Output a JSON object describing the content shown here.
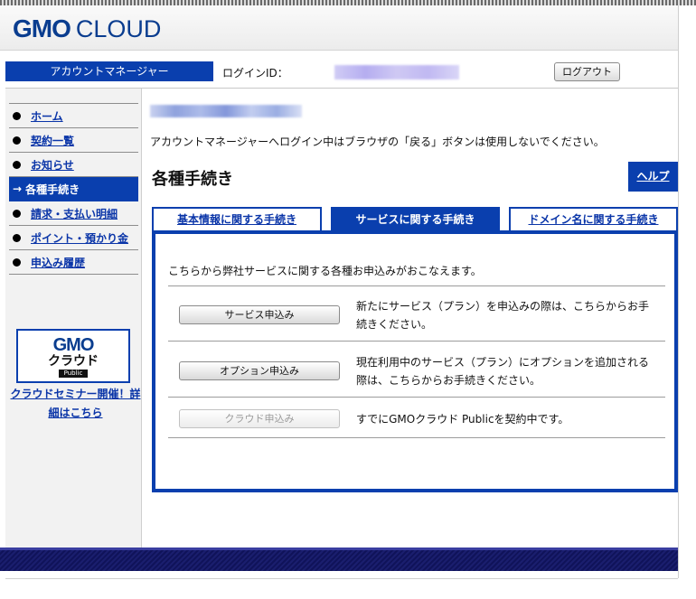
{
  "header": {
    "logo_primary": "GMO",
    "logo_secondary": "CLOUD"
  },
  "account_bar": {
    "title": "アカウントマネージャー",
    "login_label": "ログインID：",
    "logout_label": "ログアウト"
  },
  "sidebar": {
    "items": [
      {
        "label": "ホーム",
        "active": false
      },
      {
        "label": "契約一覧",
        "active": false
      },
      {
        "label": "お知らせ",
        "active": false
      },
      {
        "label": "各種手続き",
        "active": true
      },
      {
        "label": "請求・支払い明細",
        "active": false
      },
      {
        "label": "ポイント・預かり金",
        "active": false
      },
      {
        "label": "申込み履歴",
        "active": false
      }
    ],
    "active_arrow": "→",
    "banner": {
      "gmo": "GMO",
      "cloud": "クラウド",
      "public": "Public"
    },
    "seminar_link": "クラウドセミナー開催！詳細はこちら"
  },
  "main": {
    "notice": "アカウントマネージャーへログイン中はブラウザの「戻る」ボタンは使用しないでください。",
    "section_title": "各種手続き",
    "help_label": "ヘルプ",
    "tabs": [
      {
        "label": "基本情報に関する手続き",
        "active": false
      },
      {
        "label": "サービスに関する手続き",
        "active": true
      },
      {
        "label": "ドメイン名に関する手続き",
        "active": false
      }
    ],
    "panel_intro": "こちらから弊社サービスに関する各種お申込みがおこなえます。",
    "services": [
      {
        "button": "サービス申込み",
        "description": "新たにサービス（プラン）を申込みの際は、こちらからお手続きください。",
        "enabled": true
      },
      {
        "button": "オプション申込み",
        "description": "現在利用中のサービス（プラン）にオプションを追加される際は、こちらからお手続きください。",
        "enabled": true
      },
      {
        "button": "クラウド申込み",
        "description": "すでにGMOクラウド Publicを契約中です。",
        "enabled": false
      }
    ]
  },
  "colors": {
    "brand_blue": "#0a3fae",
    "link_blue": "#0a35a8",
    "footer_navy": "#10135a"
  }
}
